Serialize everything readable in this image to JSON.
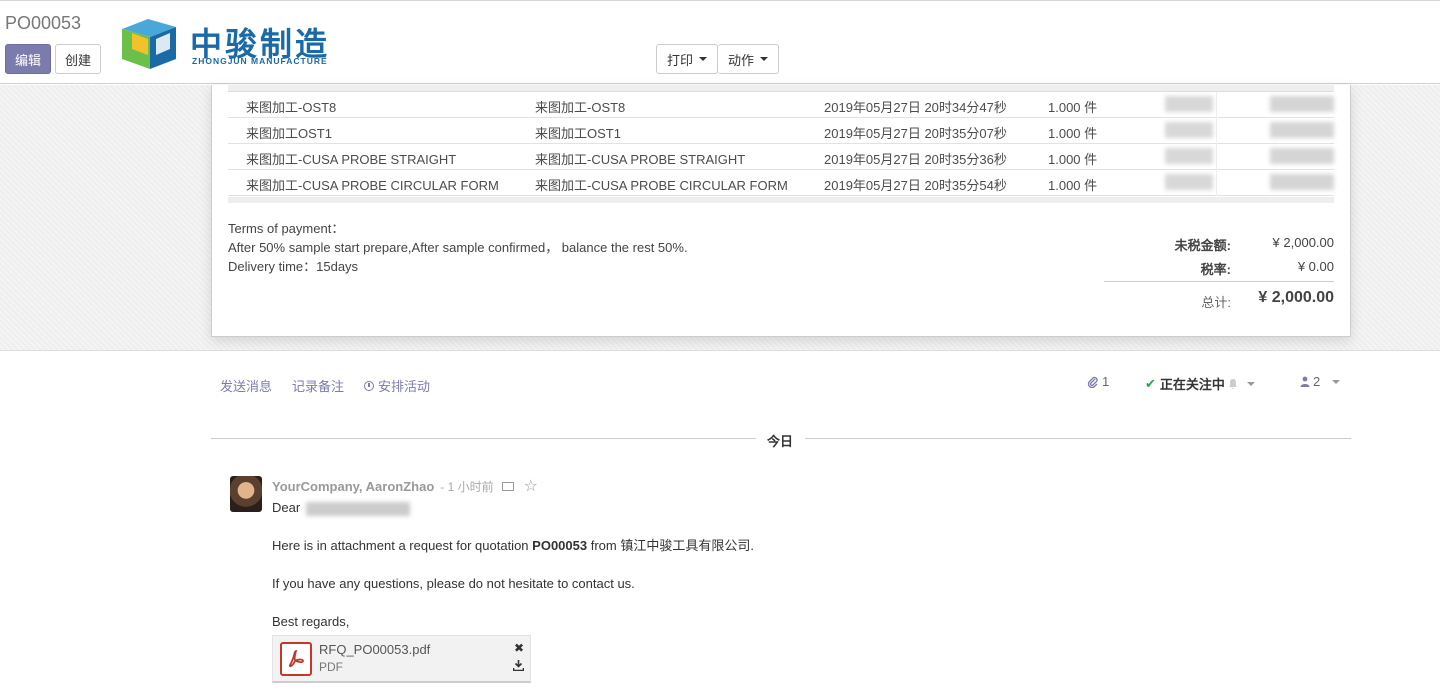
{
  "breadcrumb": "PO00053",
  "buttons": {
    "edit": "编辑",
    "create": "创建",
    "print": "打印",
    "action": "动作"
  },
  "logo": {
    "name_cn": "中骏制造",
    "name_en": "ZHONGJUN MANUFACTURE"
  },
  "order_lines": [
    {
      "product": "来图加工-OST8",
      "description": "来图加工-OST8",
      "date": "2019年05月27日 20时34分47秒",
      "quantity": "1.000 件"
    },
    {
      "product": "来图加工OST1",
      "description": "来图加工OST1",
      "date": "2019年05月27日 20时35分07秒",
      "quantity": "1.000 件"
    },
    {
      "product": "来图加工-CUSA PROBE STRAIGHT",
      "description": "来图加工-CUSA PROBE STRAIGHT",
      "date": "2019年05月27日 20时35分36秒",
      "quantity": "1.000 件"
    },
    {
      "product": "来图加工-CUSA PROBE CIRCULAR FORM",
      "description": "来图加工-CUSA PROBE CIRCULAR FORM",
      "date": "2019年05月27日 20时35分54秒",
      "quantity": "1.000 件"
    }
  ],
  "terms": {
    "line1": "Terms of payment：",
    "line2": "After 50% sample start prepare,After sample confirmed， balance the rest 50%.",
    "line3": " Delivery time：15days"
  },
  "totals": {
    "untaxed_label": "未税金额:",
    "untaxed_value": "¥ 2,000.00",
    "tax_label": "税率:",
    "tax_value": "¥ 0.00",
    "total_label": "总计:",
    "total_value": "¥ 2,000.00"
  },
  "chatter": {
    "send_message": "发送消息",
    "log_note": "记录备注",
    "schedule_activity": "安排活动",
    "attachments_count": "1",
    "following": "正在关注中",
    "followers_count": "2",
    "today": "今日"
  },
  "message": {
    "author": "YourCompany, AaronZhao",
    "time": "- 1 小时前",
    "greeting": "Dear",
    "line1_pre": "Here is in attachment a request for quotation ",
    "line1_bold": "PO00053",
    "line1_post": " from 镇江中骏工具有限公司.",
    "line2": "If you have any questions, please do not hesitate to contact us.",
    "line3": "Best regards,",
    "attachment": {
      "name": "RFQ_PO00053.pdf",
      "type": "PDF"
    }
  },
  "colors": {
    "primary": "#7c7bad",
    "logo_blue": "#1a6aa8",
    "follow_check": "#28a745",
    "pdf_red": "#c0392b"
  }
}
